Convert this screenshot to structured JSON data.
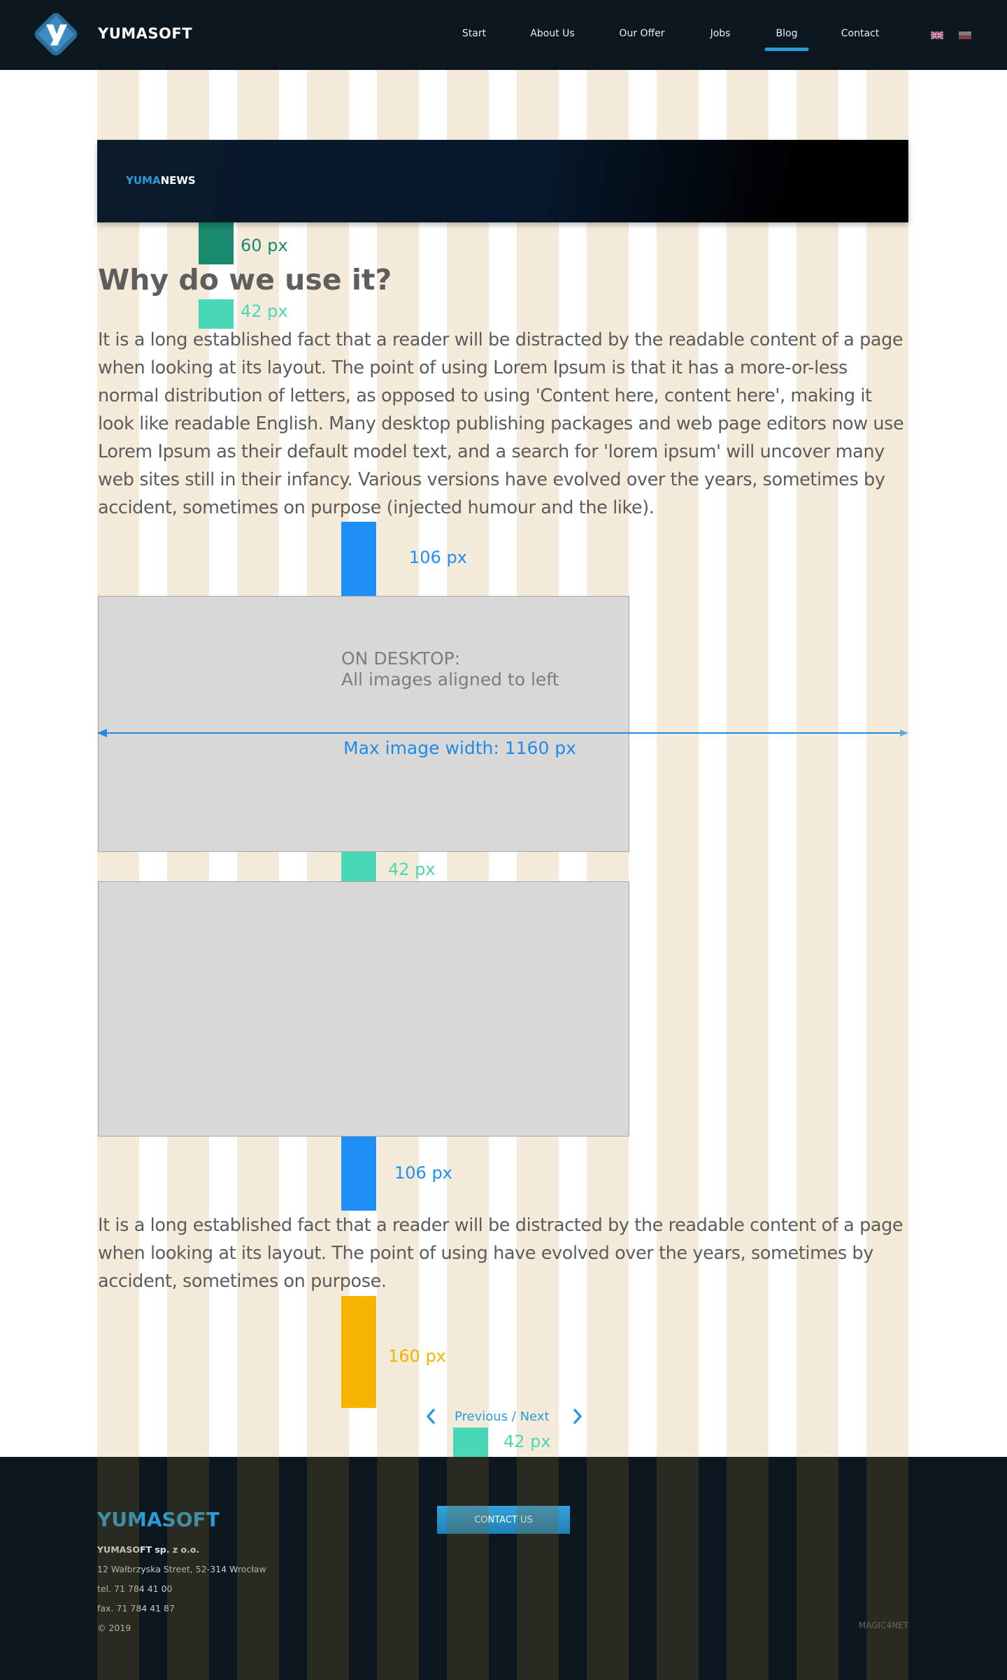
{
  "header": {
    "brand": "YUMASOFT",
    "nav": [
      {
        "label": "Start"
      },
      {
        "label": "About Us"
      },
      {
        "label": "Our Offer"
      },
      {
        "label": "Jobs"
      },
      {
        "label": "Blog",
        "active": true
      },
      {
        "label": "Contact"
      }
    ],
    "languages": [
      "flag-uk-icon",
      "flag-pl-icon"
    ]
  },
  "banner": {
    "title_a": "YUMA",
    "title_b": "NEWS"
  },
  "article": {
    "heading": "Why do we use it?",
    "paragraph_1": "It is a long established fact that a reader will be distracted by the readable content of a page when looking at its layout. The point of using Lorem Ipsum is that it has a more-or-less normal distribution of letters, as opposed to using 'Content here, content here', making it look like readable English. Many desktop publishing packages and web page editors now use Lorem Ipsum as their default model text, and a search for 'lorem ipsum' will uncover many web sites still in their infancy. Various versions have evolved over the years, sometimes by accident, sometimes on purpose (injected humour and the like).",
    "paragraph_2": "It is a long established fact that a reader will be distracted by the readable content of a page when looking at its layout. The point of using  have evolved over the years, sometimes by accident, sometimes on purpose.",
    "image_note_1": "ON DESKTOP:",
    "image_note_2": "All images aligned to left",
    "max_width_label": "Max image width: 1160 px"
  },
  "spacers": {
    "s60": "60 px",
    "s42a": "42 px",
    "s106a": "106 px",
    "s42b": "42 px",
    "s106b": "106 px",
    "s160": "160 px",
    "s42c": "42 px"
  },
  "pager": {
    "label": "Previous / Next"
  },
  "footer": {
    "brand": "YUMASOFT",
    "company": "YUMASOFT sp. z o.o.",
    "street": "12 Wałbrzyska Street, 52-314 Wrocław",
    "tel": "tel. 71 784 41 00",
    "fax": "fax. 71 784 41 87",
    "copyright": "© 2019",
    "contact_button": "CONTACT US",
    "credit": "MAGIC4NET"
  },
  "colors": {
    "accent": "#2a9dd9",
    "spacer_60": "#1a8a6e",
    "spacer_42": "#48d8b6",
    "spacer_106": "#1e8ff5",
    "spacer_160": "#f5b400",
    "stripe": "#f5ebda"
  }
}
